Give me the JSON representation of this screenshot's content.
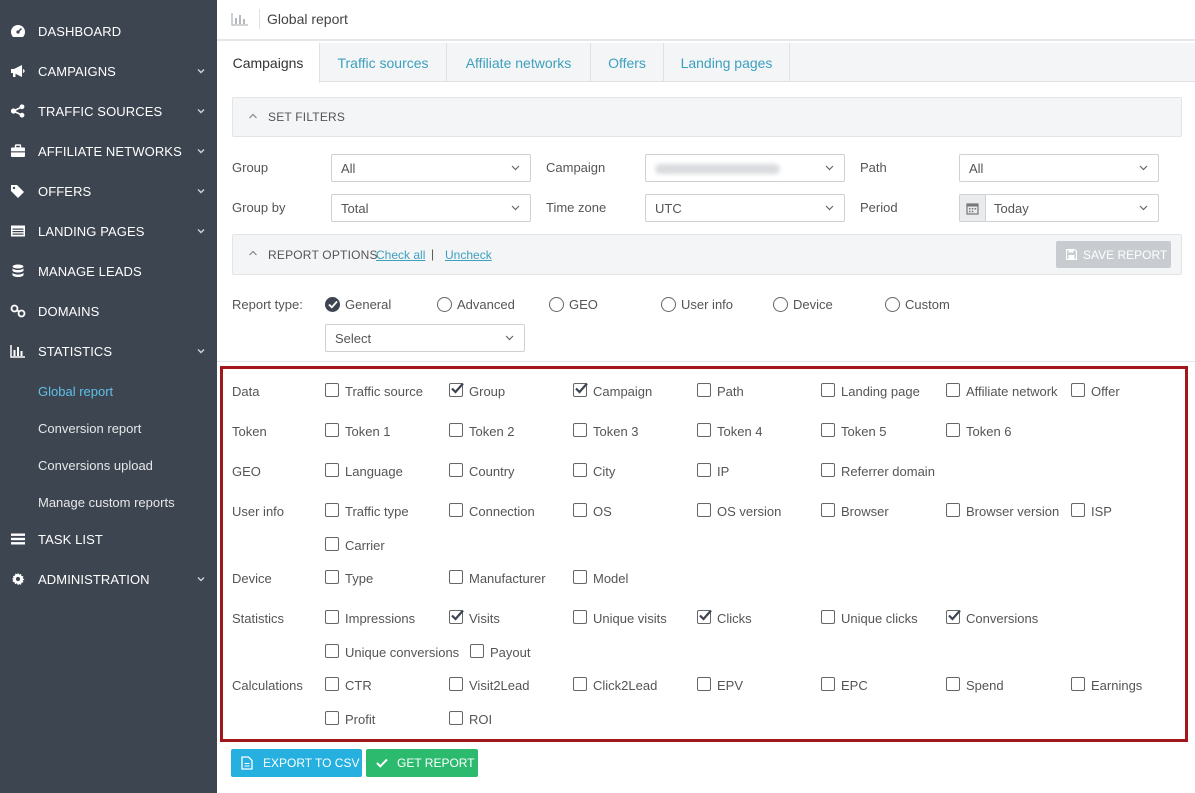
{
  "sidebar": {
    "items": [
      {
        "label": "DASHBOARD",
        "icon": "dashboard-icon",
        "expandable": false
      },
      {
        "label": "CAMPAIGNS",
        "icon": "megaphone-icon",
        "expandable": true
      },
      {
        "label": "TRAFFIC SOURCES",
        "icon": "share-icon",
        "expandable": true
      },
      {
        "label": "AFFILIATE NETWORKS",
        "icon": "briefcase-icon",
        "expandable": true
      },
      {
        "label": "OFFERS",
        "icon": "tags-icon",
        "expandable": true
      },
      {
        "label": "LANDING PAGES",
        "icon": "browser-icon",
        "expandable": true
      },
      {
        "label": "MANAGE LEADS",
        "icon": "database-icon",
        "expandable": false
      },
      {
        "label": "DOMAINS",
        "icon": "link-icon",
        "expandable": false
      },
      {
        "label": "STATISTICS",
        "icon": "bar-chart-icon",
        "expandable": true
      }
    ],
    "statistics_sub": [
      {
        "label": "Global report",
        "active": true
      },
      {
        "label": "Conversion report",
        "active": false
      },
      {
        "label": "Conversions upload",
        "active": false
      },
      {
        "label": "Manage custom reports",
        "active": false
      }
    ],
    "bottom_items": [
      {
        "label": "TASK LIST",
        "icon": "list-icon",
        "expandable": false
      },
      {
        "label": "ADMINISTRATION",
        "icon": "gear-icon",
        "expandable": true
      }
    ]
  },
  "header": {
    "title": "Global report",
    "icon": "bar-chart-icon"
  },
  "tabs": [
    {
      "label": "Campaigns",
      "active": true
    },
    {
      "label": "Traffic sources",
      "active": false
    },
    {
      "label": "Affiliate networks",
      "active": false
    },
    {
      "label": "Offers",
      "active": false
    },
    {
      "label": "Landing pages",
      "active": false
    }
  ],
  "filters": {
    "title": "SET FILTERS",
    "group_label": "Group",
    "group_value": "All",
    "campaign_label": "Campaign",
    "campaign_value": "",
    "path_label": "Path",
    "path_value": "All",
    "groupby_label": "Group by",
    "groupby_value": "Total",
    "timezone_label": "Time zone",
    "timezone_value": "UTC",
    "period_label": "Period",
    "period_value": "Today"
  },
  "report_options": {
    "title": "REPORT OPTIONS",
    "check_all": "Check all",
    "separator": "|",
    "uncheck": "Uncheck",
    "save_label": "SAVE REPORT"
  },
  "report_type": {
    "label": "Report type:",
    "options": [
      {
        "label": "General",
        "selected": true
      },
      {
        "label": "Advanced",
        "selected": false
      },
      {
        "label": "GEO",
        "selected": false
      },
      {
        "label": "User info",
        "selected": false
      },
      {
        "label": "Device",
        "selected": false
      },
      {
        "label": "Custom",
        "selected": false
      }
    ],
    "select_placeholder": "Select"
  },
  "data_options": {
    "data_label": "Data",
    "data": [
      {
        "label": "Traffic source",
        "checked": false
      },
      {
        "label": "Group",
        "checked": true
      },
      {
        "label": "Campaign",
        "checked": true
      },
      {
        "label": "Path",
        "checked": false
      },
      {
        "label": "Landing page",
        "checked": false
      },
      {
        "label": "Affiliate network",
        "checked": false
      },
      {
        "label": "Offer",
        "checked": false
      }
    ],
    "token_label": "Token",
    "token": [
      {
        "label": "Token 1",
        "checked": false
      },
      {
        "label": "Token 2",
        "checked": false
      },
      {
        "label": "Token 3",
        "checked": false
      },
      {
        "label": "Token 4",
        "checked": false
      },
      {
        "label": "Token 5",
        "checked": false
      },
      {
        "label": "Token 6",
        "checked": false
      }
    ],
    "geo_label": "GEO",
    "geo": [
      {
        "label": "Language",
        "checked": false
      },
      {
        "label": "Country",
        "checked": false
      },
      {
        "label": "City",
        "checked": false
      },
      {
        "label": "IP",
        "checked": false
      },
      {
        "label": "Referrer domain",
        "checked": false
      }
    ],
    "userinfo_label": "User info",
    "userinfo": [
      {
        "label": "Traffic type",
        "checked": false
      },
      {
        "label": "Connection",
        "checked": false
      },
      {
        "label": "OS",
        "checked": false
      },
      {
        "label": "OS version",
        "checked": false
      },
      {
        "label": "Browser",
        "checked": false
      },
      {
        "label": "Browser version",
        "checked": false
      },
      {
        "label": "ISP",
        "checked": false
      },
      {
        "label": "Carrier",
        "checked": false
      }
    ],
    "device_label": "Device",
    "device": [
      {
        "label": "Type",
        "checked": false
      },
      {
        "label": "Manufacturer",
        "checked": false
      },
      {
        "label": "Model",
        "checked": false
      }
    ],
    "statistics_label": "Statistics",
    "statistics": [
      {
        "label": "Impressions",
        "checked": false
      },
      {
        "label": "Visits",
        "checked": true
      },
      {
        "label": "Unique visits",
        "checked": false
      },
      {
        "label": "Clicks",
        "checked": true
      },
      {
        "label": "Unique clicks",
        "checked": false
      },
      {
        "label": "Conversions",
        "checked": true
      },
      {
        "label": "Unique conversions",
        "checked": false
      },
      {
        "label": "Payout",
        "checked": false
      }
    ],
    "calculations_label": "Calculations",
    "calculations": [
      {
        "label": "CTR",
        "checked": false
      },
      {
        "label": "Visit2Lead",
        "checked": false
      },
      {
        "label": "Click2Lead",
        "checked": false
      },
      {
        "label": "EPV",
        "checked": false
      },
      {
        "label": "EPC",
        "checked": false
      },
      {
        "label": "Spend",
        "checked": false
      },
      {
        "label": "Earnings",
        "checked": false
      },
      {
        "label": "Profit",
        "checked": false
      },
      {
        "label": "ROI",
        "checked": false
      }
    ]
  },
  "actions": {
    "export_label": "EXPORT TO CSV",
    "get_report_label": "GET REPORT"
  },
  "colors": {
    "sidebar_bg": "#3d4550",
    "accent": "#3ca0bf",
    "active_sub": "#5fc0e8",
    "export_btn": "#25b0e0",
    "get_report_btn": "#2bba6e",
    "highlight_border": "#a3161a"
  }
}
